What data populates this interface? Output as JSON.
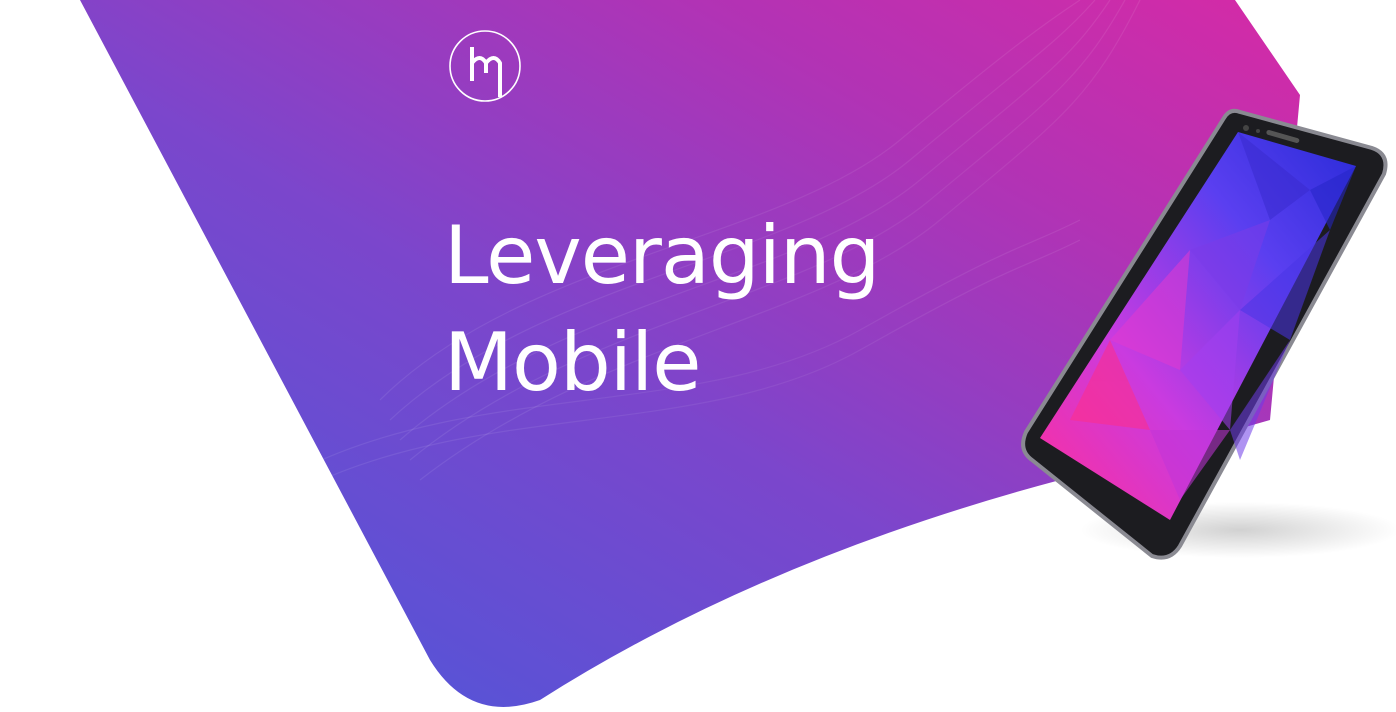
{
  "hero": {
    "title_line_1": "Leveraging",
    "title_line_2": "Mobile"
  },
  "brand": {
    "logo_icon": "hm-monogram-icon"
  },
  "illustration": {
    "device": "smartphone-illustration"
  },
  "colors": {
    "gradient_start": "#4a5ad8",
    "gradient_mid": "#8b3fc6",
    "gradient_end": "#d42aa8",
    "text": "#ffffff",
    "background": "#ffffff"
  }
}
